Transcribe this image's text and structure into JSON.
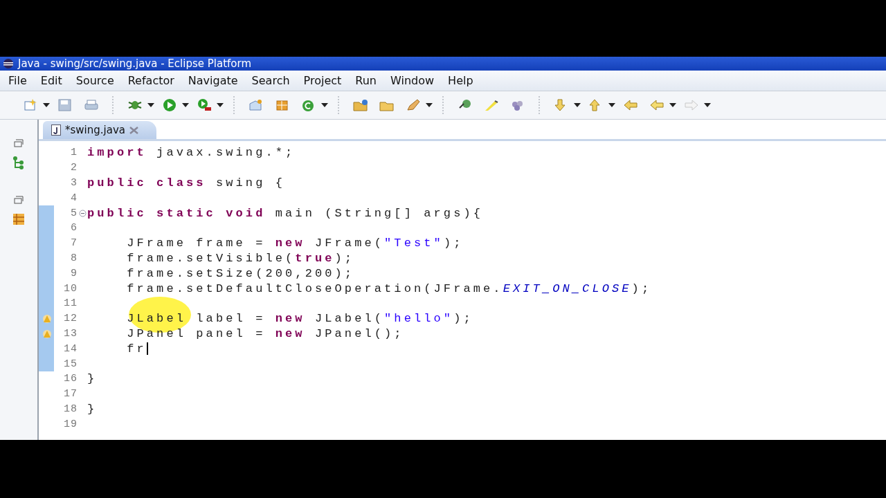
{
  "window": {
    "title": "Java - swing/src/swing.java - Eclipse Platform"
  },
  "menu": [
    {
      "label": "File"
    },
    {
      "label": "Edit"
    },
    {
      "label": "Source"
    },
    {
      "label": "Refactor"
    },
    {
      "label": "Navigate"
    },
    {
      "label": "Search"
    },
    {
      "label": "Project"
    },
    {
      "label": "Run"
    },
    {
      "label": "Window"
    },
    {
      "label": "Help"
    }
  ],
  "editor": {
    "tab": {
      "label": "*swing.java",
      "selected": true
    },
    "lines": [
      {
        "number": "1",
        "changed": false,
        "segments": [
          {
            "kind": "keyword",
            "text": "import"
          },
          {
            "kind": "plain",
            "text": " javax.swing.*;"
          }
        ]
      },
      {
        "number": "2",
        "changed": false
      },
      {
        "number": "3",
        "changed": false,
        "segments": [
          {
            "kind": "keyword",
            "text": "public class"
          },
          {
            "kind": "plain",
            "text": " swing {"
          }
        ]
      },
      {
        "number": "4",
        "changed": false
      },
      {
        "number": "5",
        "changed": true,
        "fold": true,
        "segments": [
          {
            "kind": "keyword",
            "text": "public static void"
          },
          {
            "kind": "plain",
            "text": " main (String[] args){"
          }
        ]
      },
      {
        "number": "6",
        "changed": true
      },
      {
        "number": "7",
        "changed": true,
        "segments": [
          {
            "kind": "plain",
            "text": "    JFrame frame = "
          },
          {
            "kind": "keyword",
            "text": "new"
          },
          {
            "kind": "plain",
            "text": " JFrame("
          },
          {
            "kind": "string",
            "text": "\"Test\""
          },
          {
            "kind": "plain",
            "text": ");"
          }
        ]
      },
      {
        "number": "8",
        "changed": true,
        "segments": [
          {
            "kind": "plain",
            "text": "    frame.setVisible("
          },
          {
            "kind": "keyword",
            "text": "true"
          },
          {
            "kind": "plain",
            "text": ");"
          }
        ]
      },
      {
        "number": "9",
        "changed": true,
        "segments": [
          {
            "kind": "plain",
            "text": "    frame.setSize(200,200);"
          }
        ]
      },
      {
        "number": "10",
        "changed": true,
        "segments": [
          {
            "kind": "plain",
            "text": "    frame.setDefaultCloseOperation(JFrame."
          },
          {
            "kind": "constant",
            "text": "EXIT_ON_CLOSE"
          },
          {
            "kind": "plain",
            "text": ");"
          }
        ]
      },
      {
        "number": "11",
        "changed": true
      },
      {
        "number": "12",
        "changed": true,
        "warning": true,
        "segments": [
          {
            "kind": "plain",
            "text": "    JLabel label = "
          },
          {
            "kind": "keyword",
            "text": "new"
          },
          {
            "kind": "plain",
            "text": " JLabel("
          },
          {
            "kind": "string",
            "text": "\"hello\""
          },
          {
            "kind": "plain",
            "text": ");"
          }
        ]
      },
      {
        "number": "13",
        "changed": true,
        "warning": true,
        "segments": [
          {
            "kind": "plain",
            "text": "    JPanel panel = "
          },
          {
            "kind": "keyword",
            "text": "new"
          },
          {
            "kind": "plain",
            "text": " JPanel();"
          }
        ]
      },
      {
        "number": "14",
        "changed": true,
        "caret": true,
        "segments": [
          {
            "kind": "plain",
            "text": "    fr"
          }
        ]
      },
      {
        "number": "15",
        "changed": true
      },
      {
        "number": "16",
        "changed": false,
        "segments": [
          {
            "kind": "plain",
            "text": "}"
          }
        ]
      },
      {
        "number": "17",
        "changed": false
      },
      {
        "number": "18",
        "changed": false,
        "segments": [
          {
            "kind": "plain",
            "text": "}"
          }
        ]
      },
      {
        "number": "19",
        "changed": false
      }
    ]
  }
}
